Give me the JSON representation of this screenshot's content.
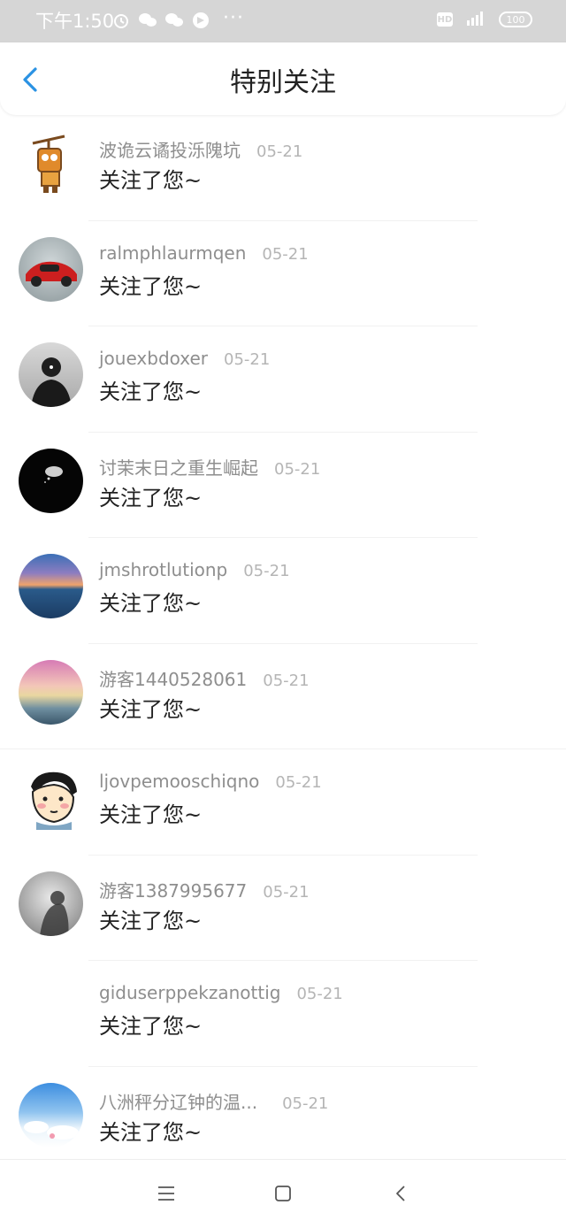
{
  "status_bar": {
    "time": "下午1:50",
    "icons_left": [
      "alarm-icon",
      "wechat-icon",
      "wechat-icon",
      "app-icon"
    ],
    "more": "···",
    "icons_right": [
      "hd-icon",
      "signal-4g-icon",
      "battery-icon"
    ],
    "hd": "HD",
    "battery": "100"
  },
  "header": {
    "title": "特别关注",
    "back_icon": "chevron-left-icon",
    "accent_color": "#2a92e3"
  },
  "items": [
    {
      "name": "波诡云谲投泺隗坑",
      "date": "05-21",
      "message": "关注了您~",
      "avatar": "robot-avatar"
    },
    {
      "name": "ralmphlaurmqen",
      "date": "05-21",
      "message": "关注了您~",
      "avatar": "red-car-avatar"
    },
    {
      "name": "jouexbdoxer",
      "date": "05-21",
      "message": "关注了您~",
      "avatar": "person-avatar"
    },
    {
      "name": "讨茉末日之重生崛起",
      "date": "05-21",
      "message": "关注了您~",
      "avatar": "dark-avatar"
    },
    {
      "name": "jmshrotlutionp",
      "date": "05-21",
      "message": "关注了您~",
      "avatar": "sunset-avatar"
    },
    {
      "name": "游客1440528061",
      "date": "05-21",
      "message": "关注了您~",
      "avatar": "pink-sky-avatar"
    },
    {
      "name": "ljovpemooschiqno",
      "date": "05-21",
      "message": "关注了您~",
      "avatar": "cartoon-face-avatar"
    },
    {
      "name": "游客1387995677",
      "date": "05-21",
      "message": "关注了您~",
      "avatar": "misty-avatar"
    },
    {
      "name": "giduserppekzanottig",
      "date": "05-21",
      "message": "关注了您~",
      "avatar": "blank-avatar"
    },
    {
      "name": "八洲秤分辽钟的温...",
      "date": "05-21",
      "message": "关注了您~",
      "avatar": "blue-sky-avatar"
    }
  ],
  "nav_bar": {
    "icons": [
      "menu-icon",
      "home-square-icon",
      "back-triangle-icon"
    ]
  }
}
